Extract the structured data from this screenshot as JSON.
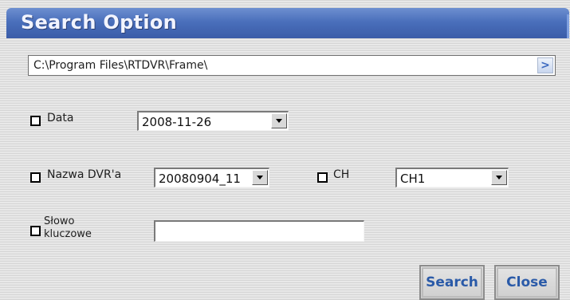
{
  "window": {
    "title": "Search Option"
  },
  "path": {
    "value": "C:\\Program Files\\RTDVR\\Frame\\",
    "browse_icon": ">"
  },
  "date_filter": {
    "label": "Data",
    "checked": false,
    "value": "2008-11-26"
  },
  "dvr_filter": {
    "label": "Nazwa DVR'a",
    "checked": false,
    "value": "20080904_11"
  },
  "channel_filter": {
    "label": "CH",
    "checked": false,
    "value": "CH1"
  },
  "keyword_filter": {
    "label_line1": "Słowo",
    "label_line2": "kluczowe",
    "checked": false,
    "value": ""
  },
  "buttons": {
    "search_label": "Search",
    "close_label": "Close"
  },
  "colors": {
    "title_bar": "#4a6fbb",
    "button_text": "#2a5aa8"
  }
}
